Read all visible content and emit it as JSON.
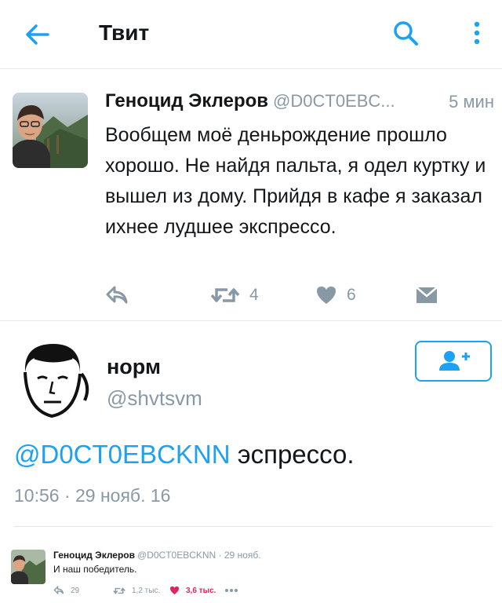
{
  "header": {
    "title": "Твит",
    "back_icon": "arrow-left-icon",
    "search_icon": "search-icon",
    "more_icon": "more-vertical-icon",
    "accent_color": "#1da1f2"
  },
  "parent_tweet": {
    "name": "Геноцид Эклеров",
    "handle": "@D0CT0EBC...",
    "time": "5 мин",
    "text": "Вообщем моё деньрождение прошло хорошо. Не найдя пальта, я одел куртку и вышел из дому. Прийдя в кафе я заказал ихнее лудшее экспрессо.",
    "retweets": "4",
    "likes": "6"
  },
  "focus_tweet": {
    "name": "норм",
    "handle": "@shvtsvm",
    "mention": "@D0CT0EBCKNN",
    "text": " эспрессо.",
    "timestamp": "10:56 · 29 нояб. 16",
    "follow_icon": "follow-user-icon"
  },
  "reply_tweet": {
    "name": "Геноцид Эклеров",
    "handle": "@D0CT0EBCKNN · 29 нояб.",
    "text": "И наш победитель.",
    "replies": "29",
    "retweets": "1,2 тыс.",
    "likes": "3,6 тыс.",
    "like_color": "#e0245e"
  }
}
